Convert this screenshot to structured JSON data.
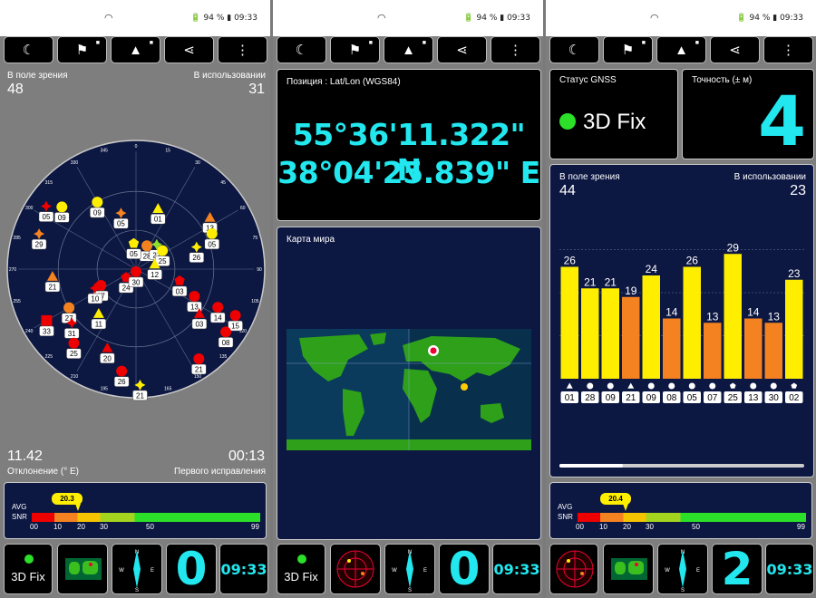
{
  "status": {
    "battery": "94 %",
    "time": "09:33"
  },
  "skyview": {
    "in_view_label": "В поле зрения",
    "in_view": "48",
    "in_use_label": "В использовании",
    "in_use": "31",
    "deviation": "11.42",
    "deviation_label": "Отклонение (° E)",
    "first_fix": "00:13",
    "first_fix_label": "Первого исправления",
    "compass_labels": [
      "0",
      "15",
      "30",
      "45",
      "60",
      "75",
      "90",
      "105",
      "120",
      "135",
      "150",
      "165",
      "180",
      "195",
      "210",
      "225",
      "240",
      "255",
      "270",
      "285",
      "300",
      "315",
      "330",
      "345"
    ],
    "satellites": [
      {
        "id": "01",
        "az": 20,
        "el": 40,
        "shape": "tri",
        "color": "#ffee00"
      },
      {
        "id": "09",
        "az": 330,
        "el": 30,
        "shape": "circ",
        "color": "#ffee00"
      },
      {
        "id": "05",
        "az": 345,
        "el": 45,
        "shape": "star4",
        "color": "#f58220"
      },
      {
        "id": "09",
        "az": 310,
        "el": 15,
        "shape": "circ",
        "color": "#ffee00"
      },
      {
        "id": "05",
        "az": 305,
        "el": 5,
        "shape": "star4",
        "color": "#e00"
      },
      {
        "id": "28",
        "az": 25,
        "el": 70,
        "shape": "circ",
        "color": "#f58220"
      },
      {
        "id": "21",
        "az": 40,
        "el": 65,
        "shape": "star4",
        "color": "#8be02a"
      },
      {
        "id": "25",
        "az": 55,
        "el": 65,
        "shape": "circ",
        "color": "#ffee00"
      },
      {
        "id": "13",
        "az": 55,
        "el": 20,
        "shape": "tri",
        "color": "#f58220"
      },
      {
        "id": "05",
        "az": 355,
        "el": 70,
        "shape": "pent",
        "color": "#ffee00"
      },
      {
        "id": "26",
        "az": 70,
        "el": 40,
        "shape": "star4",
        "color": "#ffee00"
      },
      {
        "id": "05",
        "az": 65,
        "el": 25,
        "shape": "circ",
        "color": "#ffee00"
      },
      {
        "id": "29",
        "az": 290,
        "el": 10,
        "shape": "star4",
        "color": "#f58220"
      },
      {
        "id": "12",
        "az": 75,
        "el": 75,
        "shape": "tri",
        "color": "#ffee00"
      },
      {
        "id": "24",
        "az": 230,
        "el": 80,
        "shape": "pent",
        "color": "#e00"
      },
      {
        "id": "30",
        "az": 180,
        "el": 88,
        "shape": "circ",
        "color": "#e00"
      },
      {
        "id": "03",
        "az": 105,
        "el": 55,
        "shape": "pent",
        "color": "#e00"
      },
      {
        "id": "13",
        "az": 115,
        "el": 40,
        "shape": "circ",
        "color": "#e00"
      },
      {
        "id": "14",
        "az": 115,
        "el": 20,
        "shape": "circ",
        "color": "#e00"
      },
      {
        "id": "03",
        "az": 125,
        "el": 30,
        "shape": "tri",
        "color": "#e00"
      },
      {
        "id": "15",
        "az": 115,
        "el": 5,
        "shape": "circ",
        "color": "#e00"
      },
      {
        "id": "08",
        "az": 125,
        "el": 5,
        "shape": "circ",
        "color": "#e00"
      },
      {
        "id": "21",
        "az": 145,
        "el": 5,
        "shape": "circ",
        "color": "#e00"
      },
      {
        "id": "21",
        "az": 178,
        "el": 0,
        "shape": "star4",
        "color": "#ffee00"
      },
      {
        "id": "26",
        "az": 188,
        "el": 10,
        "shape": "circ",
        "color": "#e00"
      },
      {
        "id": "20",
        "az": 200,
        "el": 25,
        "shape": "tri",
        "color": "#e00"
      },
      {
        "id": "07",
        "az": 245,
        "el": 60,
        "shape": "circ",
        "color": "#e00"
      },
      {
        "id": "10",
        "az": 245,
        "el": 55,
        "shape": "star4",
        "color": "#e00"
      },
      {
        "id": "11",
        "az": 220,
        "el": 45,
        "shape": "tri",
        "color": "#ffee00"
      },
      {
        "id": "21",
        "az": 265,
        "el": 25,
        "shape": "tri",
        "color": "#f58220"
      },
      {
        "id": "27",
        "az": 240,
        "el": 30,
        "shape": "circ",
        "color": "#f58220"
      },
      {
        "id": "31",
        "az": 230,
        "el": 25,
        "shape": "star4",
        "color": "#e00"
      },
      {
        "id": "33",
        "az": 240,
        "el": 10,
        "shape": "sq",
        "color": "#e00"
      },
      {
        "id": "25",
        "az": 220,
        "el": 15,
        "shape": "circ",
        "color": "#e00"
      }
    ]
  },
  "snr1": {
    "avg": "AVG",
    "snr": "SNR",
    "value": "20.3",
    "ticks": [
      "00",
      "10",
      "20",
      "30",
      "50",
      "99"
    ]
  },
  "position": {
    "title": "Позиция : Lat/Lon (WGS84)",
    "lat": "55°36'11.322\" N",
    "lon": "38°04'25.839\" E"
  },
  "map": {
    "title": "Карта мира"
  },
  "gnss": {
    "title": "Статус GNSS",
    "fix": "3D Fix",
    "acc_title": "Точность (± м)",
    "acc": "4"
  },
  "bars": {
    "in_view_label": "В поле зрения",
    "in_view": "44",
    "in_use_label": "В использовании",
    "in_use": "23"
  },
  "chart_data": {
    "type": "bar",
    "categories": [
      "01",
      "28",
      "09",
      "21",
      "09",
      "08",
      "05",
      "07",
      "25",
      "13",
      "30",
      "02"
    ],
    "values": [
      26,
      21,
      21,
      19,
      24,
      14,
      26,
      13,
      29,
      14,
      13,
      23
    ],
    "colors": [
      "#ffee00",
      "#ffee00",
      "#ffee00",
      "#f58220",
      "#ffee00",
      "#f58220",
      "#ffee00",
      "#f58220",
      "#ffee00",
      "#f58220",
      "#f58220",
      "#ffee00"
    ],
    "markers": [
      "tri",
      "circ",
      "circ",
      "tri",
      "circ",
      "circ",
      "circ",
      "circ",
      "pent",
      "circ",
      "circ",
      "pent"
    ],
    "ylim": [
      0,
      40
    ]
  },
  "snr2": {
    "avg": "AVG",
    "snr": "SNR",
    "value": "20.4",
    "ticks": [
      "00",
      "10",
      "20",
      "30",
      "50",
      "99"
    ]
  },
  "bottom": {
    "fix": "3D Fix",
    "count1": "0",
    "time1": "09:33",
    "count2": "0",
    "time2": "09:33",
    "count3": "2",
    "time3": "09:33",
    "compass": [
      "N",
      "W",
      "E",
      "S"
    ]
  }
}
